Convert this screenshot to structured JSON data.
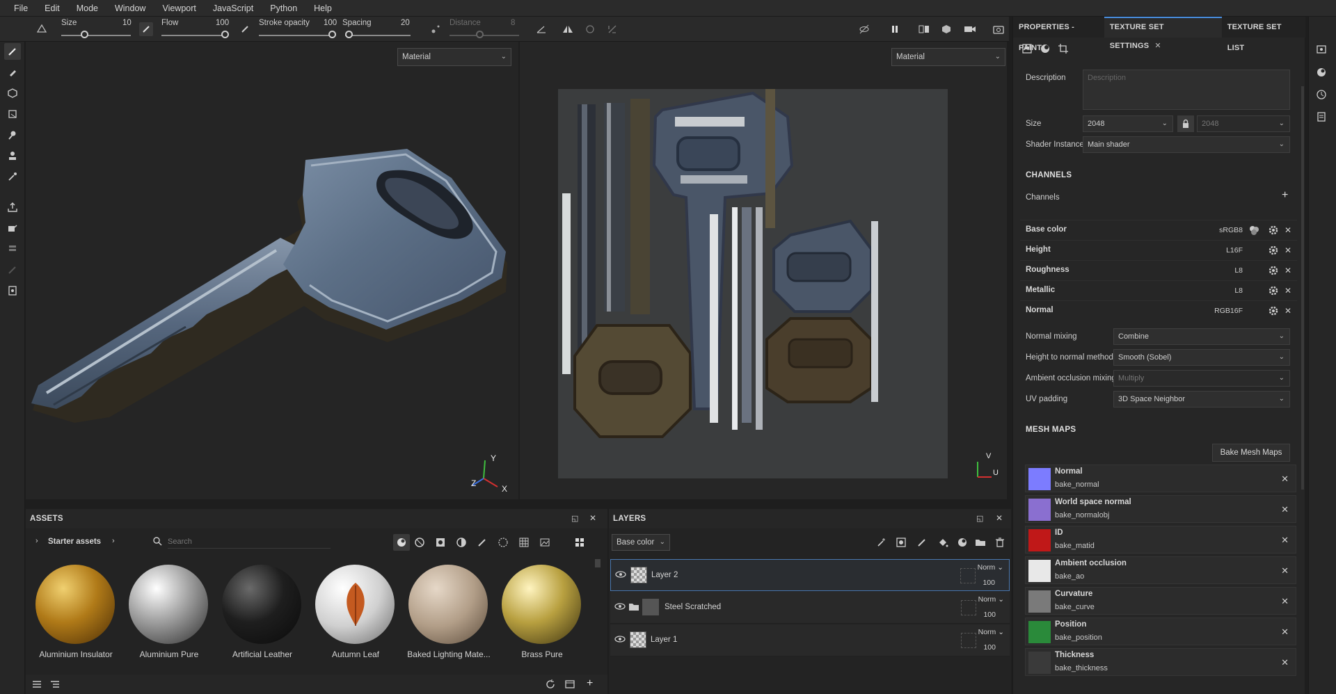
{
  "menu": [
    "File",
    "Edit",
    "Mode",
    "Window",
    "Viewport",
    "JavaScript",
    "Python",
    "Help"
  ],
  "toolbar": {
    "size_label": "Size",
    "size_value": "10",
    "flow_label": "Flow",
    "flow_value": "100",
    "stroke_label": "Stroke opacity",
    "stroke_value": "100",
    "spacing_label": "Spacing",
    "spacing_value": "20",
    "distance_label": "Distance",
    "distance_value": "8"
  },
  "viewport3d": {
    "material_select": "Material"
  },
  "viewport2d": {
    "material_select": "Material"
  },
  "axes3d": {
    "y": "Y",
    "z": "Z",
    "x": "X"
  },
  "axes2d": {
    "v": "V",
    "u": "U"
  },
  "right_panel": {
    "tabs": [
      "PROPERTIES - PAINT",
      "TEXTURE SET SETTINGS",
      "TEXTURE SET LIST"
    ],
    "description_label": "Description",
    "description_placeholder": "Description",
    "size_label": "Size",
    "size_value": "2048",
    "size_value_locked": "2048",
    "shader_label": "Shader Instance",
    "shader_value": "Main shader",
    "channels_heading": "CHANNELS",
    "channels_label": "Channels",
    "channels": [
      {
        "name": "Base color",
        "format": "sRGB8"
      },
      {
        "name": "Height",
        "format": "L16F"
      },
      {
        "name": "Roughness",
        "format": "L8"
      },
      {
        "name": "Metallic",
        "format": "L8"
      },
      {
        "name": "Normal",
        "format": "RGB16F"
      }
    ],
    "normal_mixing_label": "Normal mixing",
    "normal_mixing_value": "Combine",
    "height_normal_label": "Height to normal method",
    "height_normal_value": "Smooth (Sobel)",
    "ao_mixing_label": "Ambient occlusion mixing",
    "ao_mixing_value": "Multiply",
    "uv_padding_label": "UV padding",
    "uv_padding_value": "3D Space Neighbor",
    "mesh_maps_heading": "MESH MAPS",
    "bake_button": "Bake Mesh Maps",
    "mesh_maps": [
      {
        "name": "Normal",
        "file": "bake_normal",
        "color": "#7c7cff"
      },
      {
        "name": "World space normal",
        "file": "bake_normalobj",
        "color": "#8a6fd0"
      },
      {
        "name": "ID",
        "file": "bake_matid",
        "color": "#c01818"
      },
      {
        "name": "Ambient occlusion",
        "file": "bake_ao",
        "color": "#e8e8e8"
      },
      {
        "name": "Curvature",
        "file": "bake_curve",
        "color": "#7a7a7a"
      },
      {
        "name": "Position",
        "file": "bake_position",
        "color": "#2a8a3a"
      },
      {
        "name": "Thickness",
        "file": "bake_thickness",
        "color": "#3a3a3a"
      }
    ]
  },
  "assets": {
    "title": "ASSETS",
    "breadcrumb": "Starter assets",
    "search_placeholder": "Search",
    "items": [
      {
        "name": "Aluminium Insulator"
      },
      {
        "name": "Aluminium Pure"
      },
      {
        "name": "Artificial Leather"
      },
      {
        "name": "Autumn Leaf"
      },
      {
        "name": "Baked Lighting Mate..."
      },
      {
        "name": "Brass Pure"
      }
    ]
  },
  "layers": {
    "title": "LAYERS",
    "channel_select": "Base color",
    "rows": [
      {
        "name": "Layer 2",
        "blend": "Norm",
        "opacity": "100"
      },
      {
        "name": "Steel Scratched",
        "blend": "Norm",
        "opacity": "100"
      },
      {
        "name": "Layer 1",
        "blend": "Norm",
        "opacity": "100"
      }
    ]
  },
  "colors": {
    "accent": "#4a90e2",
    "panel_bg": "#262626",
    "viewport_bg": "#252525"
  }
}
